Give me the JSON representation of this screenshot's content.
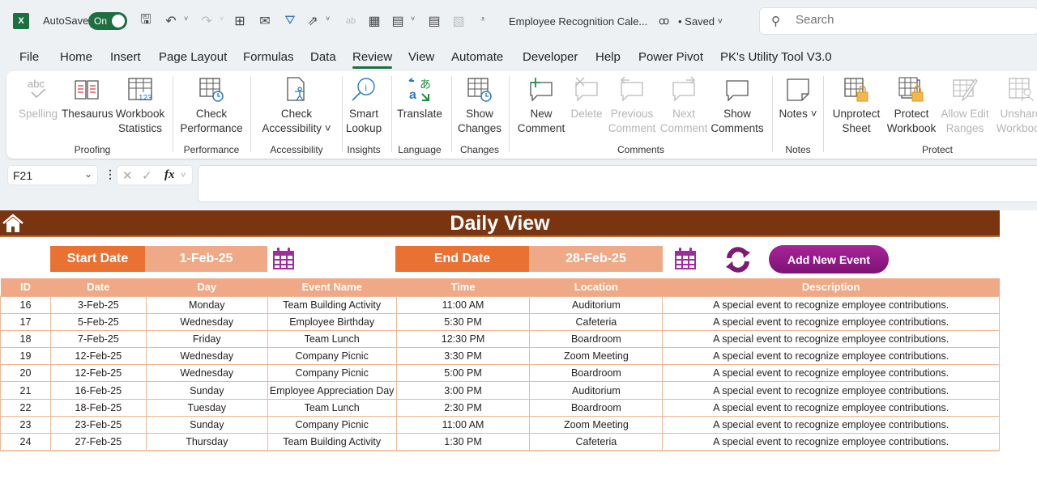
{
  "titlebar": {
    "app_icon": "excel-icon",
    "autosave_label": "AutoSave",
    "autosave_state": "On",
    "quick_access": [
      "save-sync-icon",
      "undo-icon",
      "redo-icon",
      "borders-icon",
      "attach-icon",
      "filter-icon",
      "share-icon",
      "spelling-icon",
      "table-icon",
      "calculator-icon",
      "calculator-2-icon",
      "form-icon",
      "customize-icon"
    ],
    "doc_title": "Employee Recognition Cale...",
    "saved_status": "• Saved",
    "search_placeholder": "Search"
  },
  "tabs": [
    {
      "label": "File"
    },
    {
      "label": "Home"
    },
    {
      "label": "Insert"
    },
    {
      "label": "Page Layout"
    },
    {
      "label": "Formulas"
    },
    {
      "label": "Data"
    },
    {
      "label": "Review",
      "active": true
    },
    {
      "label": "View"
    },
    {
      "label": "Automate"
    },
    {
      "label": "Developer"
    },
    {
      "label": "Help"
    },
    {
      "label": "Power Pivot"
    },
    {
      "label": "PK's Utility Tool V3.0"
    }
  ],
  "ribbon": {
    "groups": {
      "proofing": "Proofing",
      "performance": "Performance",
      "accessibility": "Accessibility",
      "insights": "Insights",
      "language": "Language",
      "changes": "Changes",
      "comments": "Comments",
      "notes": "Notes",
      "protect": "Protect"
    },
    "buttons": {
      "spelling": "Spelling",
      "thesaurus": "Thesaurus",
      "workbook_statistics": "Workbook Statistics",
      "check_performance": "Check Performance",
      "check_accessibility": "Check Accessibility ˅",
      "smart_lookup": "Smart Lookup",
      "translate": "Translate",
      "show_changes": "Show Changes",
      "new_comment": "New Comment",
      "delete": "Delete",
      "previous_comment": "Previous Comment",
      "next_comment": "Next Comment",
      "show_comments": "Show Comments",
      "notes": "Notes ˅",
      "unprotect_sheet": "Unprotect Sheet",
      "protect_workbook": "Protect Workbook",
      "allow_edit_ranges": "Allow Edit Ranges",
      "unshare_workbook": "Unshare Workbook"
    }
  },
  "formula_bar": {
    "name_box": "F21",
    "cancel_icon": "✕",
    "enter_icon": "✓",
    "fx_label": "fx",
    "formula_value": ""
  },
  "sheet": {
    "title": "Daily View",
    "start_date_label": "Start Date",
    "start_date_value": "1-Feb-25",
    "end_date_label": "End Date",
    "end_date_value": "28-Feb-25",
    "add_button": "Add New Event",
    "colors": {
      "banner": "#7a3410",
      "label_orange": "#e97132",
      "value_peach": "#f0a986",
      "button_purple": "#8e1a85",
      "calendar_purple": "#a02b9c"
    },
    "columns": [
      "ID",
      "Date",
      "Day",
      "Event Name",
      "Time",
      "Location",
      "Description"
    ],
    "rows": [
      [
        "16",
        "3-Feb-25",
        "Monday",
        "Team Building Activity",
        "11:00 AM",
        "Auditorium",
        "A special event to recognize employee contributions."
      ],
      [
        "17",
        "5-Feb-25",
        "Wednesday",
        "Employee Birthday",
        "5:30 PM",
        "Cafeteria",
        "A special event to recognize employee contributions."
      ],
      [
        "18",
        "7-Feb-25",
        "Friday",
        "Team Lunch",
        "12:30 PM",
        "Boardroom",
        "A special event to recognize employee contributions."
      ],
      [
        "19",
        "12-Feb-25",
        "Wednesday",
        "Company Picnic",
        "3:30 PM",
        "Zoom Meeting",
        "A special event to recognize employee contributions."
      ],
      [
        "20",
        "12-Feb-25",
        "Wednesday",
        "Company Picnic",
        "5:00 PM",
        "Boardroom",
        "A special event to recognize employee contributions."
      ],
      [
        "21",
        "16-Feb-25",
        "Sunday",
        "Employee Appreciation Day",
        "3:00 PM",
        "Auditorium",
        "A special event to recognize employee contributions."
      ],
      [
        "22",
        "18-Feb-25",
        "Tuesday",
        "Team Lunch",
        "2:30 PM",
        "Boardroom",
        "A special event to recognize employee contributions."
      ],
      [
        "23",
        "23-Feb-25",
        "Sunday",
        "Company Picnic",
        "11:00 AM",
        "Zoom Meeting",
        "A special event to recognize employee contributions."
      ],
      [
        "24",
        "27-Feb-25",
        "Thursday",
        "Team Building Activity",
        "1:30 PM",
        "Cafeteria",
        "A special event to recognize employee contributions."
      ]
    ]
  }
}
